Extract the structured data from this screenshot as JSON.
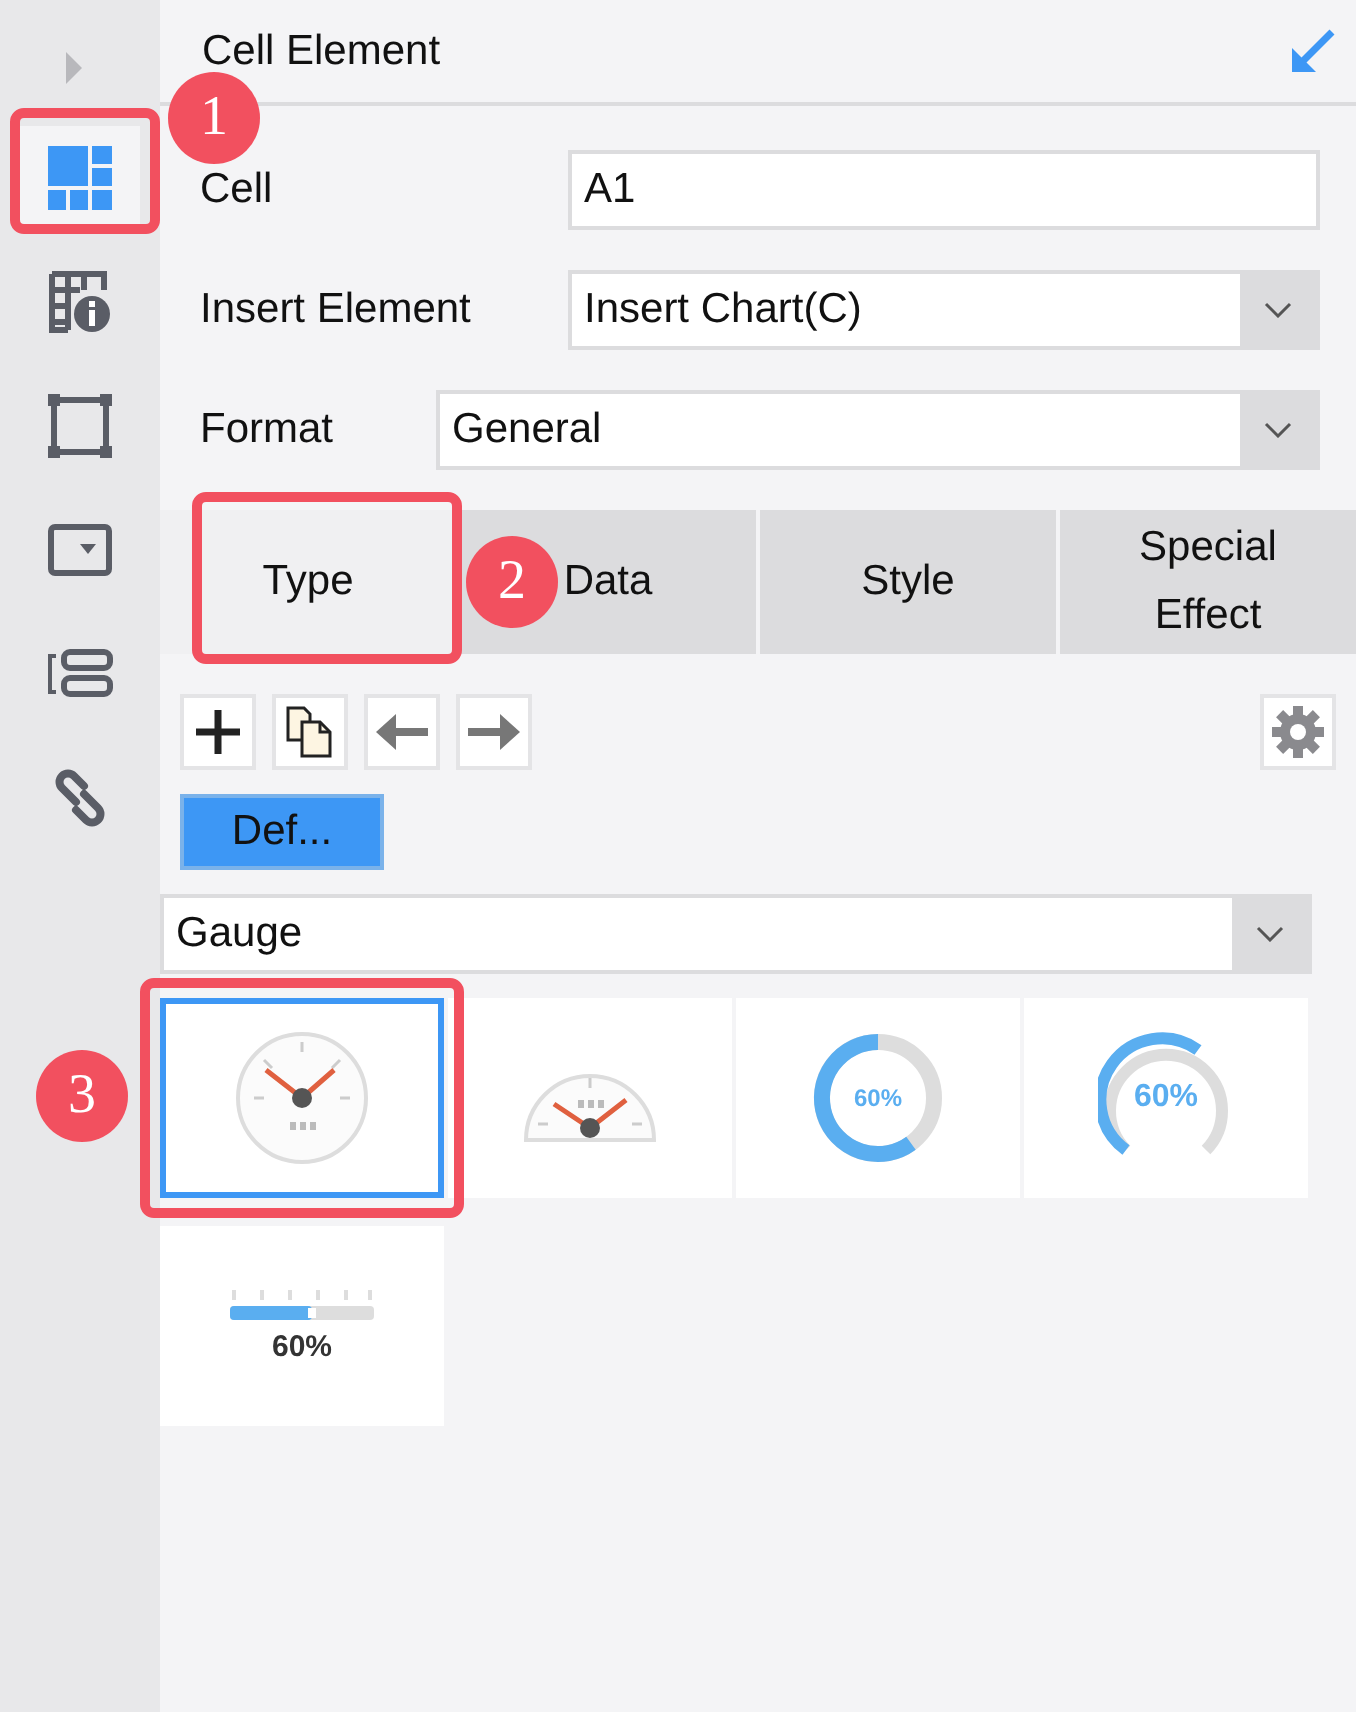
{
  "sidebar": {
    "items": [
      {
        "kind": "cell",
        "selected": true,
        "callout": "1"
      },
      {
        "kind": "table-info",
        "selected": false
      },
      {
        "kind": "frame",
        "selected": false
      },
      {
        "kind": "dropdown",
        "selected": false
      },
      {
        "kind": "list",
        "selected": false
      },
      {
        "kind": "link",
        "selected": false
      }
    ]
  },
  "panel": {
    "title": "Cell Element",
    "fields": [
      {
        "kind": "text",
        "label": "Cell",
        "value": "A1"
      },
      {
        "kind": "select",
        "label": "Insert Element",
        "value": "Insert Chart(C)"
      },
      {
        "kind": "select",
        "label": "Format",
        "value": "General"
      }
    ],
    "tabs": [
      {
        "label": "Type",
        "selected": true,
        "callout": "2"
      },
      {
        "label": "Data",
        "selected": false
      },
      {
        "label": "Style",
        "selected": false
      },
      {
        "label": "Special Effect",
        "selected": false
      }
    ],
    "toolbar": [
      {
        "kind": "add"
      },
      {
        "kind": "copy"
      },
      {
        "kind": "left"
      },
      {
        "kind": "right"
      }
    ],
    "styles": [
      {
        "label": "Def...",
        "selected": true
      }
    ],
    "chart_type": "Gauge",
    "gallery": [
      {
        "kind": "dial",
        "selected": true,
        "callout": "3"
      },
      {
        "kind": "half-dial",
        "selected": false
      },
      {
        "kind": "ring",
        "selected": false,
        "label": "60%"
      },
      {
        "kind": "arc",
        "selected": false,
        "label": "60%"
      },
      {
        "kind": "bar",
        "selected": false,
        "label": "60%"
      }
    ]
  }
}
